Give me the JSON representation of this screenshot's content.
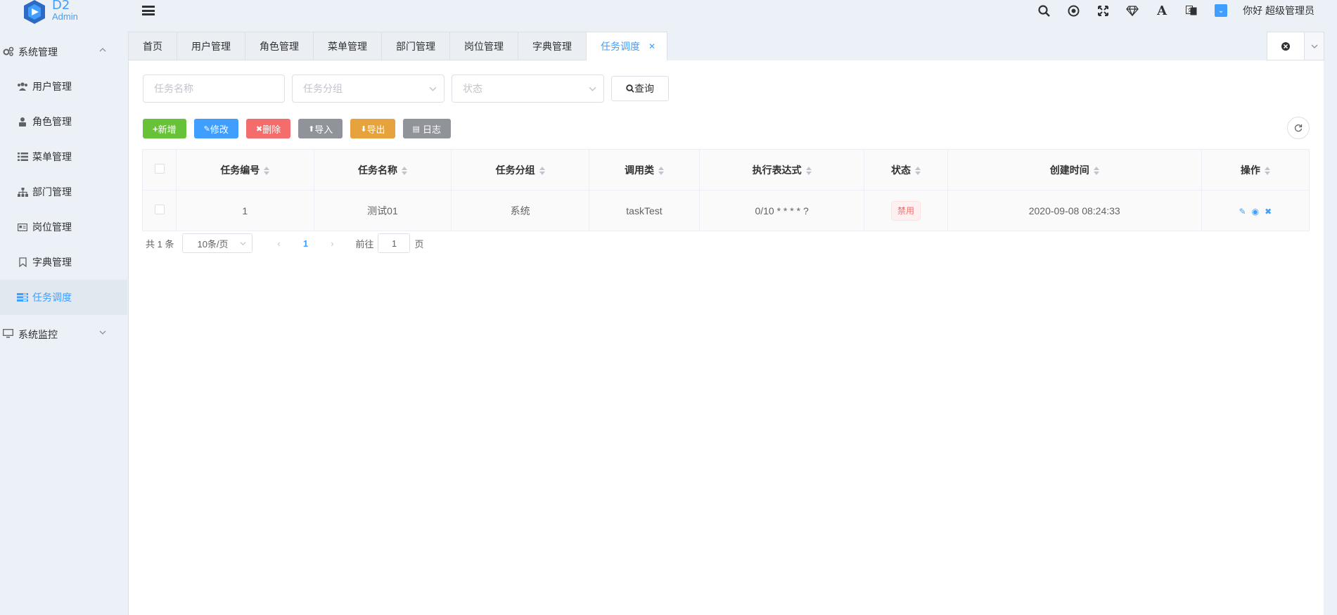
{
  "logo": {
    "brand": "D2",
    "sub": "Admin"
  },
  "header": {
    "icons": [
      "search-icon",
      "target-icon",
      "fullscreen-icon",
      "diamond-icon",
      "font-size-icon",
      "translate-icon",
      "theme-icon"
    ],
    "greeting": "你好 超级管理员"
  },
  "sidebar": {
    "groups": [
      {
        "label": "系统管理",
        "expanded": true
      },
      {
        "label": "系统监控",
        "expanded": false
      }
    ],
    "items": [
      {
        "label": "用户管理",
        "icon": "users-icon"
      },
      {
        "label": "角色管理",
        "icon": "user-role-icon"
      },
      {
        "label": "菜单管理",
        "icon": "list-icon"
      },
      {
        "label": "部门管理",
        "icon": "sitemap-icon"
      },
      {
        "label": "岗位管理",
        "icon": "id-card-icon"
      },
      {
        "label": "字典管理",
        "icon": "bookmark-icon"
      },
      {
        "label": "任务调度",
        "icon": "tasks-icon",
        "active": true
      }
    ]
  },
  "tabs": [
    {
      "label": "首页"
    },
    {
      "label": "用户管理"
    },
    {
      "label": "角色管理"
    },
    {
      "label": "菜单管理"
    },
    {
      "label": "部门管理"
    },
    {
      "label": "岗位管理"
    },
    {
      "label": "字典管理"
    },
    {
      "label": "任务调度",
      "active": true
    }
  ],
  "filter": {
    "name_placeholder": "任务名称",
    "group_placeholder": "任务分组",
    "status_placeholder": "状态",
    "query_label": "查询"
  },
  "toolbar": {
    "add": "新增",
    "edit": "修改",
    "delete": "删除",
    "import": "导入",
    "export": "导出",
    "log": "日志",
    "colors": {
      "add": "#67c23a",
      "edit": "#409eff",
      "delete": "#f56c6c",
      "import": "#909399",
      "export": "#e6a23c",
      "log": "#909399"
    }
  },
  "table": {
    "columns": [
      "任务编号",
      "任务名称",
      "任务分组",
      "调用类",
      "执行表达式",
      "状态",
      "创建时间",
      "操作"
    ],
    "rows": [
      {
        "id": "1",
        "name": "测试01",
        "group": "系统",
        "invoke": "taskTest",
        "cron": "0/10 * * * * ?",
        "status": "禁用",
        "created": "2020-09-08 08:24:33"
      }
    ]
  },
  "pager": {
    "total": "共 1 条",
    "page_size": "10条/页",
    "current": "1",
    "goto_prefix": "前往",
    "goto_value": "1",
    "goto_suffix": "页"
  }
}
